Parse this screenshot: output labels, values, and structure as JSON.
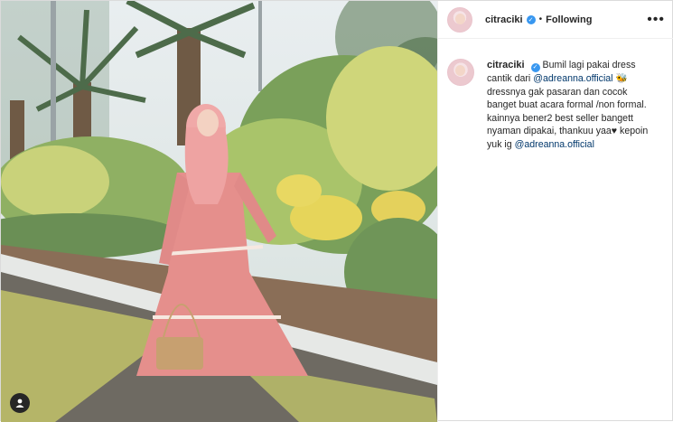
{
  "post": {
    "username": "citraciki",
    "verified_badge": "✓",
    "separator": "•",
    "follow_status": "Following",
    "more_icon": "more-horizontal-icon",
    "caption": {
      "text_1": "Bumil lagi pakai dress cantik dari ",
      "mention_1": "@adreanna.official",
      "emoji_1": "🐝",
      "text_2": "dressnya gak pasaran dan cocok banget buat acara formal /non formal. kainnya bener2 best seller bangett nyaman dipakai, thankuu yaa♥ kepoin yuk ig ",
      "mention_2": "@adreanna.official"
    }
  },
  "colors": {
    "link": "#00376b",
    "verified": "#3897f0",
    "text": "#262626",
    "dress": "#e58f8c"
  },
  "icons": {
    "tag": "user-tag-icon",
    "verified": "verified-badge-icon"
  }
}
